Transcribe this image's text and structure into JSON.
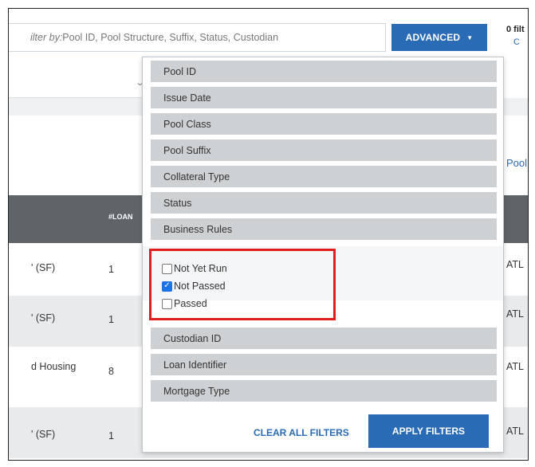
{
  "search": {
    "placeholder_label": "ilter by:",
    "placeholder_text": " Pool ID, Pool Structure, Suffix, Status, Custodian"
  },
  "advanced": {
    "label": "ADVANCED",
    "caret": "▼"
  },
  "filters": {
    "count": "0 filt",
    "link": "C"
  },
  "pool_link": "Pool",
  "table": {
    "loans_header": "#LOAN",
    "rows": [
      {
        "c1": "' (SF)",
        "c2": "1",
        "c3": "ATL"
      },
      {
        "c1": "' (SF)",
        "c2": "1",
        "c3": "ATL"
      },
      {
        "c1": "d Housing",
        "c2": "8",
        "c3": "ATL"
      },
      {
        "c1": "' (SF)",
        "c2": "1",
        "c3": "ATL"
      }
    ]
  },
  "dropdown": {
    "options_top": [
      "Pool ID",
      "Issue Date",
      "Pool Class",
      "Pool Suffix",
      "Collateral Type",
      "Status",
      "Business Rules"
    ],
    "checkboxes": [
      {
        "label": "Not Yet Run",
        "checked": false
      },
      {
        "label": "Not Passed",
        "checked": true
      },
      {
        "label": "Passed",
        "checked": false
      }
    ],
    "options_bottom": [
      "Custodian ID",
      "Loan Identifier",
      "Mortgage Type"
    ],
    "clear_label": "CLEAR ALL FILTERS",
    "apply_label": "APPLY FILTERS"
  },
  "colors": {
    "accent": "#2a6bb5",
    "highlight": "#e01e1e",
    "table_header": "#5f6468"
  },
  "icons": {
    "checked": "check-icon",
    "dropdown": "caret-down-icon",
    "chevron": "chevron-down-icon"
  }
}
